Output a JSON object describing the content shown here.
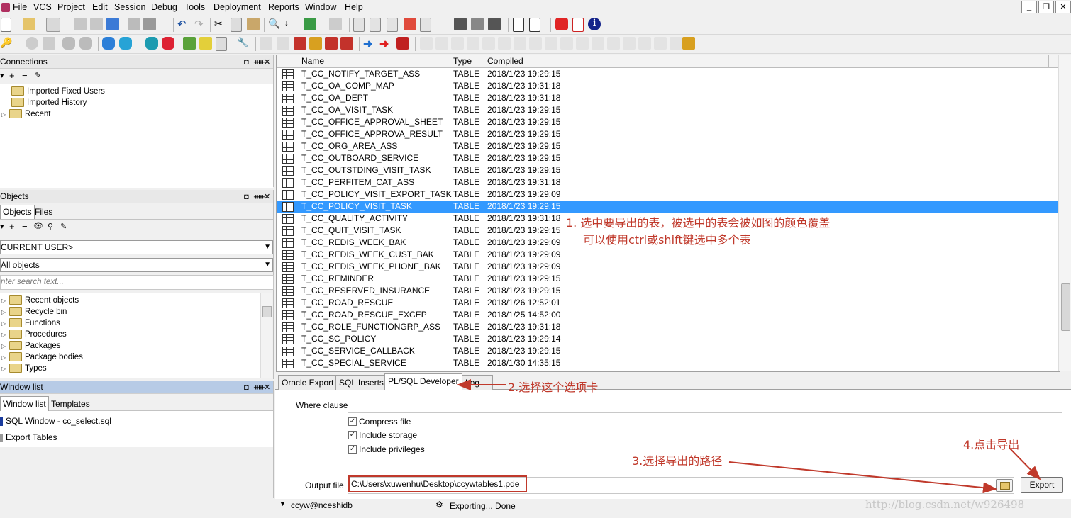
{
  "menu": [
    "File",
    "VCS",
    "Project",
    "Edit",
    "Session",
    "Debug",
    "Tools",
    "Deployment",
    "Reports",
    "Window",
    "Help"
  ],
  "window_controls": [
    "_",
    "❐",
    "✕"
  ],
  "connections": {
    "title": "Connections",
    "items": [
      "Imported Fixed Users",
      "Imported History",
      "Recent"
    ]
  },
  "objects": {
    "title": "Objects",
    "tabs": [
      "Objects",
      "Files"
    ],
    "user_combo": "CURRENT USER>",
    "filter_combo": "All objects",
    "search_placeholder": "nter search text...",
    "items": [
      "Recent objects",
      "Recycle bin",
      "Functions",
      "Procedures",
      "Packages",
      "Package bodies",
      "Types"
    ]
  },
  "window_list": {
    "title": "Window list",
    "tabs": [
      "Window list",
      "Templates"
    ],
    "items": [
      "SQL Window - cc_select.sql",
      "Export Tables"
    ]
  },
  "grid": {
    "headers": [
      "Name",
      "Type",
      "Compiled"
    ],
    "rows": [
      {
        "name": "T_CC_NOTIFY_TARGET_ASS",
        "type": "TABLE",
        "compiled": "2018/1/23 19:29:15"
      },
      {
        "name": "T_CC_OA_COMP_MAP",
        "type": "TABLE",
        "compiled": "2018/1/23 19:31:18"
      },
      {
        "name": "T_CC_OA_DEPT",
        "type": "TABLE",
        "compiled": "2018/1/23 19:31:18"
      },
      {
        "name": "T_CC_OA_VISIT_TASK",
        "type": "TABLE",
        "compiled": "2018/1/23 19:29:15"
      },
      {
        "name": "T_CC_OFFICE_APPROVAL_SHEET",
        "type": "TABLE",
        "compiled": "2018/1/23 19:29:15"
      },
      {
        "name": "T_CC_OFFICE_APPROVA_RESULT",
        "type": "TABLE",
        "compiled": "2018/1/23 19:29:15"
      },
      {
        "name": "T_CC_ORG_AREA_ASS",
        "type": "TABLE",
        "compiled": "2018/1/23 19:29:15"
      },
      {
        "name": "T_CC_OUTBOARD_SERVICE",
        "type": "TABLE",
        "compiled": "2018/1/23 19:29:15"
      },
      {
        "name": "T_CC_OUTSTDING_VISIT_TASK",
        "type": "TABLE",
        "compiled": "2018/1/23 19:29:15"
      },
      {
        "name": "T_CC_PERFITEM_CAT_ASS",
        "type": "TABLE",
        "compiled": "2018/1/23 19:31:18"
      },
      {
        "name": "T_CC_POLICY_VISIT_EXPORT_TASK",
        "type": "TABLE",
        "compiled": "2018/1/23 19:29:09"
      },
      {
        "name": "T_CC_POLICY_VISIT_TASK",
        "type": "TABLE",
        "compiled": "2018/1/23 19:29:15",
        "selected": true
      },
      {
        "name": "T_CC_QUALITY_ACTIVITY",
        "type": "TABLE",
        "compiled": "2018/1/23 19:31:18"
      },
      {
        "name": "T_CC_QUIT_VISIT_TASK",
        "type": "TABLE",
        "compiled": "2018/1/23 19:29:15"
      },
      {
        "name": "T_CC_REDIS_WEEK_BAK",
        "type": "TABLE",
        "compiled": "2018/1/23 19:29:09"
      },
      {
        "name": "T_CC_REDIS_WEEK_CUST_BAK",
        "type": "TABLE",
        "compiled": "2018/1/23 19:29:09"
      },
      {
        "name": "T_CC_REDIS_WEEK_PHONE_BAK",
        "type": "TABLE",
        "compiled": "2018/1/23 19:29:09"
      },
      {
        "name": "T_CC_REMINDER",
        "type": "TABLE",
        "compiled": "2018/1/23 19:29:15"
      },
      {
        "name": "T_CC_RESERVED_INSURANCE",
        "type": "TABLE",
        "compiled": "2018/1/23 19:29:15"
      },
      {
        "name": "T_CC_ROAD_RESCUE",
        "type": "TABLE",
        "compiled": "2018/1/26 12:52:01"
      },
      {
        "name": "T_CC_ROAD_RESCUE_EXCEP",
        "type": "TABLE",
        "compiled": "2018/1/25 14:52:00"
      },
      {
        "name": "T_CC_ROLE_FUNCTIONGRP_ASS",
        "type": "TABLE",
        "compiled": "2018/1/23 19:31:18"
      },
      {
        "name": "T_CC_SC_POLICY",
        "type": "TABLE",
        "compiled": "2018/1/23 19:29:14"
      },
      {
        "name": "T_CC_SERVICE_CALLBACK",
        "type": "TABLE",
        "compiled": "2018/1/23 19:29:15"
      },
      {
        "name": "T_CC_SPECIAL_SERVICE",
        "type": "TABLE",
        "compiled": "2018/1/30 14:35:15"
      }
    ]
  },
  "export_tabs": [
    "Oracle Export",
    "SQL Inserts",
    "PL/SQL Developer",
    "Log"
  ],
  "options": {
    "where_clause_label": "Where clause",
    "where_clause_value": "",
    "checkboxes": [
      {
        "label": "Compress file",
        "checked": true
      },
      {
        "label": "Include storage",
        "checked": true
      },
      {
        "label": "Include privileges",
        "checked": true
      }
    ],
    "output_file_label": "Output file",
    "output_file_value": "C:\\Users\\xuwenhu\\Desktop\\ccywtables1.pde",
    "export_button": "Export"
  },
  "status": {
    "connection": "ccyw@nceshidb",
    "message": "Exporting... Done"
  },
  "annotations": {
    "step1_line1": "1. 选中要导出的表，被选中的表会被如图的颜色覆盖",
    "step1_line2": "可以使用ctrl或shift键选中多个表",
    "step2": "2.选择这个选项卡",
    "step3": "3.选择导出的路径",
    "step4": "4.点击导出"
  },
  "watermark": "http://blog.csdn.net/w926498",
  "colors": {
    "selection": "#3399ff",
    "annotation": "#c0392b"
  }
}
